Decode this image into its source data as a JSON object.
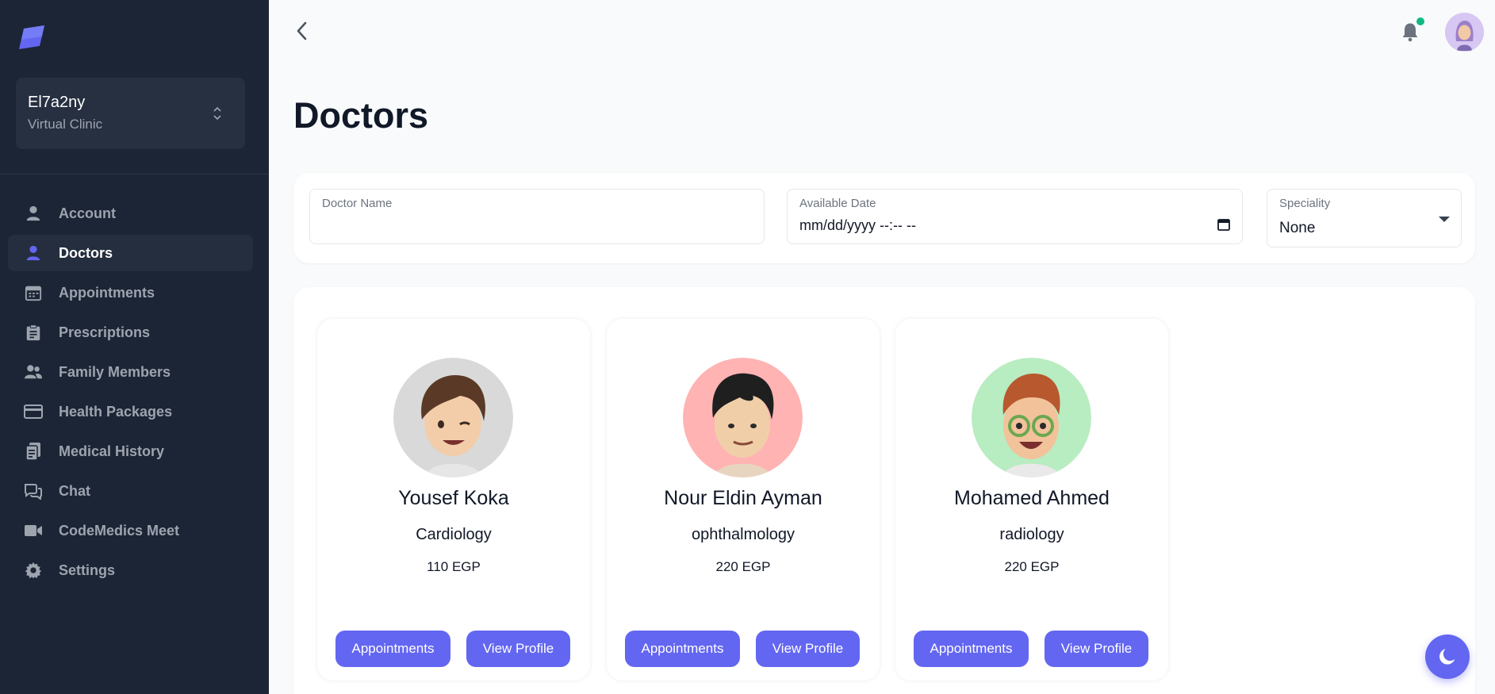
{
  "workspace": {
    "name": "El7a2ny",
    "subtitle": "Virtual Clinic"
  },
  "nav": [
    {
      "label": "Account",
      "icon": "user-icon",
      "active": false
    },
    {
      "label": "Doctors",
      "icon": "user-icon",
      "active": true
    },
    {
      "label": "Appointments",
      "icon": "calendar-icon",
      "active": false
    },
    {
      "label": "Prescriptions",
      "icon": "clipboard-icon",
      "active": false
    },
    {
      "label": "Family Members",
      "icon": "users-icon",
      "active": false
    },
    {
      "label": "Health Packages",
      "icon": "credit-card-icon",
      "active": false
    },
    {
      "label": "Medical History",
      "icon": "documents-icon",
      "active": false
    },
    {
      "label": "Chat",
      "icon": "chat-icon",
      "active": false
    },
    {
      "label": "CodeMedics Meet",
      "icon": "video-icon",
      "active": false
    },
    {
      "label": "Settings",
      "icon": "gear-icon",
      "active": false
    }
  ],
  "page": {
    "title": "Doctors"
  },
  "filters": {
    "name_label": "Doctor Name",
    "name_value": "",
    "date_label": "Available Date",
    "date_value": "mm/dd/yyyy --:-- --",
    "speciality_label": "Speciality",
    "speciality_value": "None"
  },
  "doctors": [
    {
      "name": "Yousef Koka",
      "speciality": "Cardiology",
      "fee": "110 EGP",
      "avatar_bg": "#d9d9d9",
      "appointments_label": "Appointments",
      "profile_label": "View Profile"
    },
    {
      "name": "Nour Eldin Ayman",
      "speciality": "ophthalmology",
      "fee": "220 EGP",
      "avatar_bg": "#ffb3b3",
      "appointments_label": "Appointments",
      "profile_label": "View Profile"
    },
    {
      "name": "Mohamed Ahmed",
      "speciality": "radiology",
      "fee": "220 EGP",
      "avatar_bg": "#b8ecc1",
      "appointments_label": "Appointments",
      "profile_label": "View Profile"
    }
  ],
  "colors": {
    "sidebar": "#1c2536",
    "accent": "#6366f1",
    "notification_dot": "#10b981"
  }
}
